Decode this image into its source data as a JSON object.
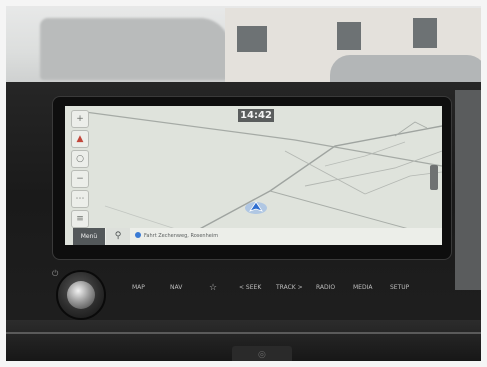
{
  "status_bar": {
    "time": "14:42"
  },
  "map": {
    "menu_label": "Menü",
    "search_icon": "search-icon",
    "destination_text": "Fahrt Zechenweg, Rosenheim"
  },
  "side_controls": [
    {
      "icon": "zoom-in-icon",
      "glyph": "+"
    },
    {
      "icon": "compass-icon",
      "glyph": "▲"
    },
    {
      "icon": "view-icon",
      "glyph": "○"
    },
    {
      "icon": "zoom-out-icon",
      "glyph": "−"
    },
    {
      "icon": "options-icon",
      "glyph": "⋯"
    },
    {
      "icon": "layers-icon",
      "glyph": "≡"
    }
  ],
  "hardware_buttons": {
    "map": "MAP",
    "nav": "NAV",
    "fav_icon": "☆",
    "seek": "< SEEK",
    "track": "TRACK >",
    "radio": "RADIO",
    "media": "MEDIA",
    "setup": "SETUP"
  },
  "colors": {
    "map_bg": "#dfe3dc",
    "road": "#9fa4a0",
    "vehicle": "#2f6fd0"
  }
}
